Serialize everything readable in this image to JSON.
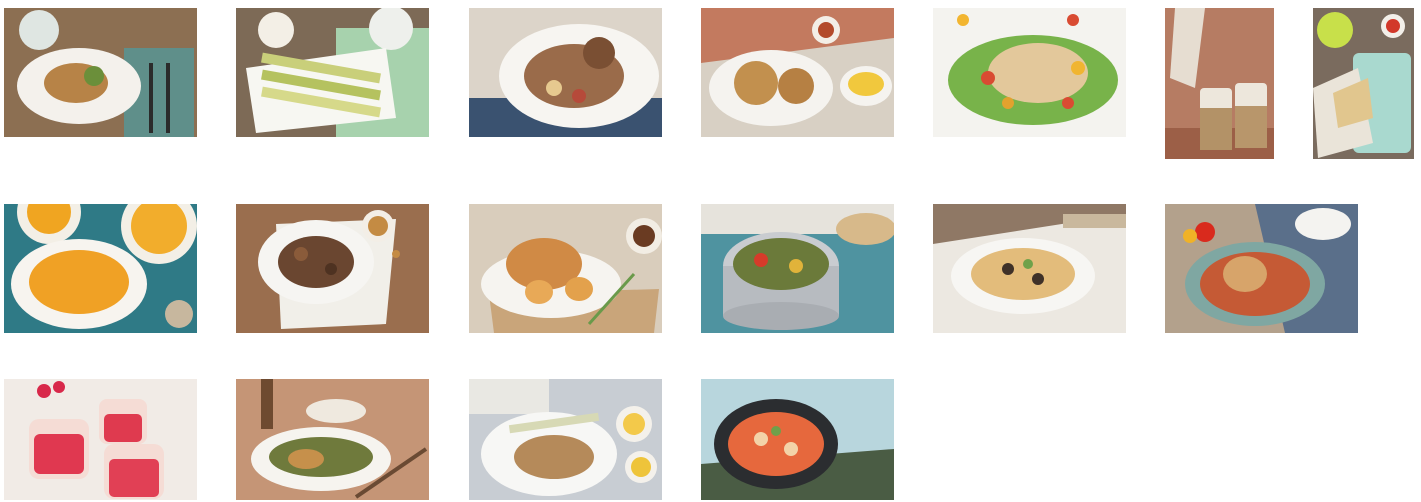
{
  "gallery": {
    "images": [
      {
        "id": 1,
        "subject": "plated-meal-with-sauce"
      },
      {
        "id": 2,
        "subject": "roasted-leeks-platter"
      },
      {
        "id": 3,
        "subject": "chicken-stew-plate"
      },
      {
        "id": 4,
        "subject": "pastry-rolls-with-pasta"
      },
      {
        "id": 5,
        "subject": "noodle-salad"
      },
      {
        "id": 6,
        "subject": "jar-desserts"
      },
      {
        "id": 7,
        "subject": "wraps-tray"
      },
      {
        "id": 8,
        "subject": "pumpkin-soup"
      },
      {
        "id": 9,
        "subject": "mushroom-dish"
      },
      {
        "id": 10,
        "subject": "roast-chicken-pears"
      },
      {
        "id": 11,
        "subject": "ratatouille-pot"
      },
      {
        "id": 12,
        "subject": "pasta-plate"
      },
      {
        "id": 13,
        "subject": "chicken-tomato-bowl"
      },
      {
        "id": 14,
        "subject": "raspberry-jelly-cups"
      },
      {
        "id": 15,
        "subject": "fish-with-herbs"
      },
      {
        "id": 16,
        "subject": "fish-fillet-leeks"
      },
      {
        "id": 17,
        "subject": "seafood-soup-pan"
      }
    ]
  }
}
